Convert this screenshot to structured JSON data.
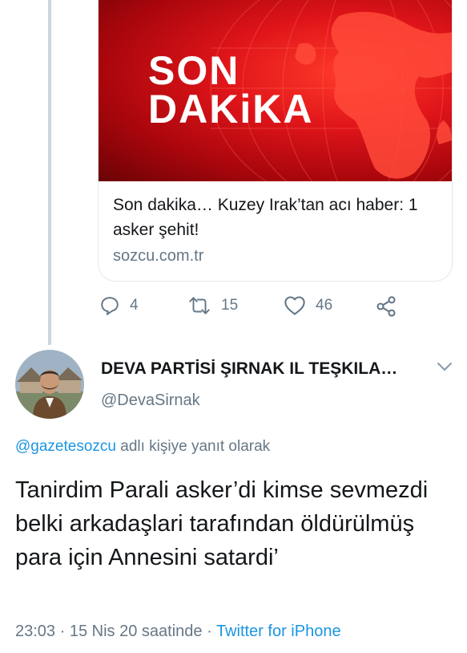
{
  "card": {
    "image_text_line1": "SON",
    "image_text_line2": "DAKiKA",
    "title": "Son dakika… Kuzey Irak’tan acı haber: 1 asker şehit!",
    "domain": "sozcu.com.tr"
  },
  "actions": {
    "reply_count": "4",
    "retweet_count": "15",
    "like_count": "46"
  },
  "tweet": {
    "display_name": "DEVA PARTİSİ ŞIRNAK IL TEŞKILA…",
    "handle": "@DevaSirnak",
    "reply_mention": "@gazetesozcu",
    "reply_suffix": " adlı kişiye yanıt olarak",
    "text": "Tanirdim Parali asker’di kimse sevmezdi belki arkadaşlari tarafından öldürülmüş para için Annesini satardi’",
    "time": "23:03",
    "sep1": " · ",
    "date": "15 Nis 20 saatinde",
    "sep2": " · ",
    "source": "Twitter for iPhone"
  },
  "colors": {
    "accent": "#1b95e0",
    "muted": "#657786",
    "text": "#14171a"
  }
}
